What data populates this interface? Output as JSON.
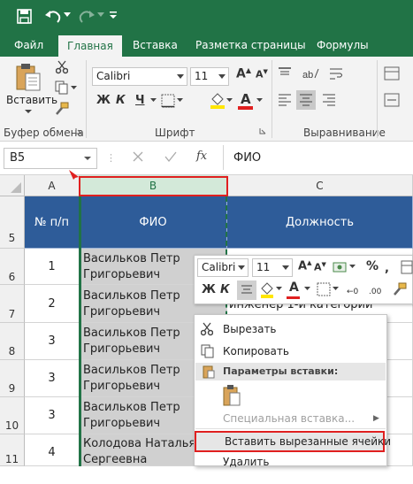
{
  "qat": {
    "save": "save-icon",
    "undo": "undo-icon",
    "redo": "redo-icon",
    "customize": "chevron-down-icon"
  },
  "tabs": [
    "Файл",
    "Главная",
    "Вставка",
    "Разметка страницы",
    "Формулы"
  ],
  "active_tab": "Главная",
  "ribbon": {
    "paste_label": "Вставить",
    "clipboard_group": "Буфер обмена",
    "font_group": "Шрифт",
    "align_group": "Выравнивание",
    "font_name": "Calibri",
    "font_size": "11",
    "bold": "Ж",
    "italic": "К",
    "underline": "Ч",
    "font_letter": "A"
  },
  "formula_bar": {
    "name_box": "B5",
    "fx": "fx",
    "value": "ФИО"
  },
  "columns": {
    "a": "A",
    "b": "B",
    "c": "C"
  },
  "rows": [
    "5",
    "6",
    "7",
    "8",
    "9",
    "10",
    "11"
  ],
  "table": {
    "header": {
      "num": "№ п/п",
      "fio": "ФИО",
      "pos": "Должность"
    },
    "data": [
      {
        "num": "1",
        "fio1": "Васильков Петр",
        "fio2": "Григорьевич",
        "pos": ""
      },
      {
        "num": "2",
        "fio1": "Васильков Петр",
        "fio2": "Григорьевич",
        "pos": "инженер 1-й категории"
      },
      {
        "num": "3",
        "fio1": "Васильков Петр",
        "fio2": "Григорьевич",
        "pos": ""
      },
      {
        "num": "3",
        "fio1": "Васильков Петр",
        "fio2": "Григорьевич",
        "pos": ""
      },
      {
        "num": "3",
        "fio1": "Васильков Петр",
        "fio2": "Григорьевич",
        "pos": ""
      },
      {
        "num": "4",
        "fio1": "Колодова Наталья",
        "fio2": "Сергеевна",
        "pos": ""
      }
    ]
  },
  "mini_toolbar": {
    "font": "Calibri",
    "size": "11",
    "percent": "%",
    "bold": "Ж",
    "italic": "К"
  },
  "context_menu": {
    "cut": "Вырезать",
    "copy": "Копировать",
    "paste_options": "Параметры вставки:",
    "paste_special": "Специальная вставка...",
    "insert_cut": "Вставить вырезанные ячейки",
    "delete": "Удалить"
  },
  "colors": {
    "excel_green": "#217346",
    "header_blue": "#2e5c99",
    "highlight_red": "#e02020",
    "selection_gray": "#d0d0d0"
  }
}
